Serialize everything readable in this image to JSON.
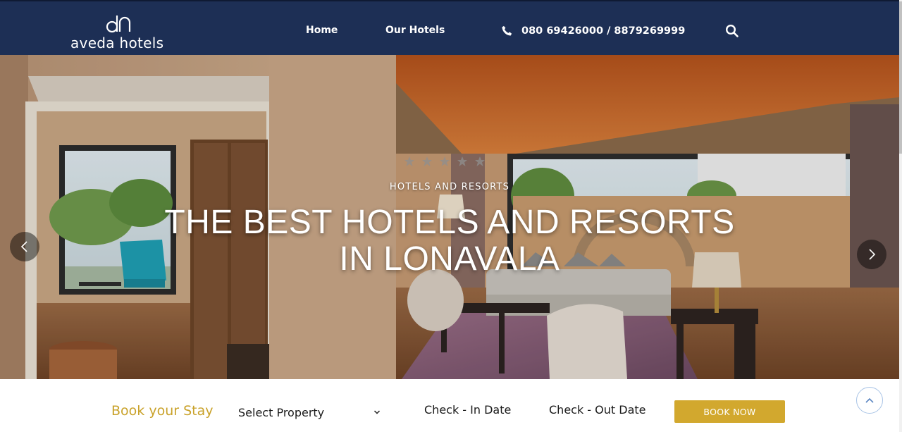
{
  "brand": {
    "logo_mark": "dn",
    "logo_text": "aveda hotels"
  },
  "nav": {
    "home": "Home",
    "our_hotels": "Our Hotels",
    "phone": "080 69426000 / 8879269999",
    "phone_icon": "phone-icon",
    "search_icon": "search-icon"
  },
  "hero": {
    "stars": 5,
    "subtitle": "HOTELS AND RESORTS",
    "title_line1": "THE BEST HOTELS AND RESORTS",
    "title_line2": "IN LONAVALA",
    "prev_icon": "chevron-left-icon",
    "next_icon": "chevron-right-icon"
  },
  "booking": {
    "title": "Book your Stay",
    "select_property": "Select Property",
    "check_in": "Check - In Date",
    "check_out": "Check - Out Date",
    "book_now": "BOOK NOW",
    "scroll_top_icon": "chevron-up-icon"
  },
  "colors": {
    "header_bg": "#1d2f55",
    "accent_gold": "#c9a22a",
    "button_gold": "#d2a82e"
  }
}
